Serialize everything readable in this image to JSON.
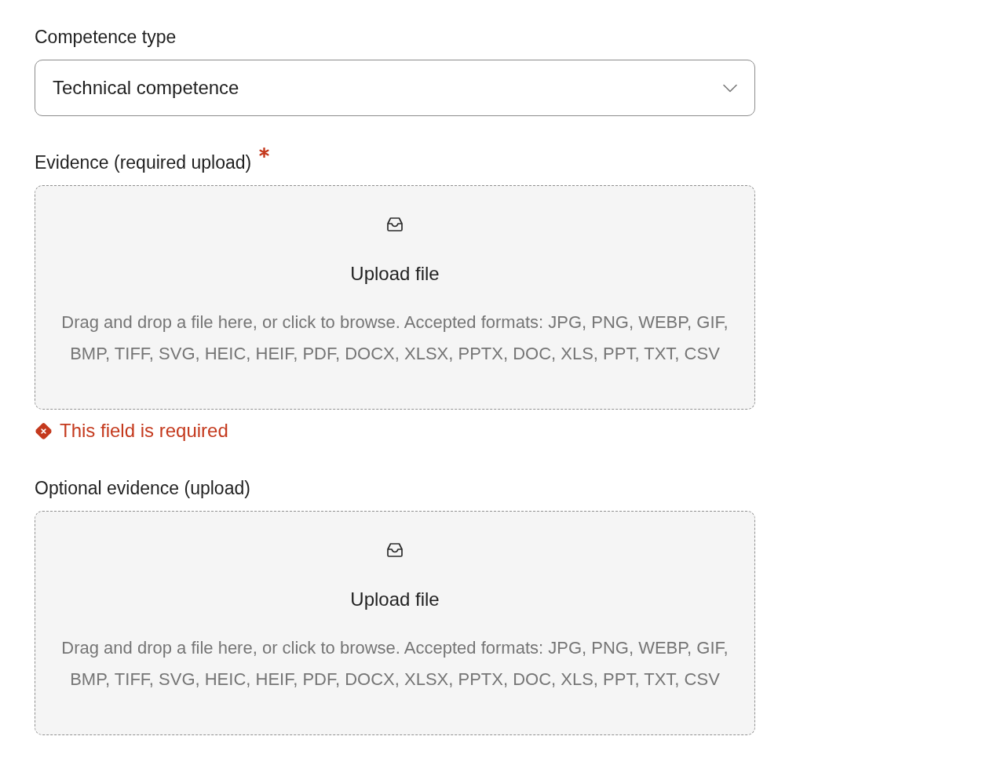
{
  "fields": [
    {
      "kind": "select",
      "label": "Competence type",
      "required": false,
      "value": "Technical competence"
    },
    {
      "kind": "upload",
      "label": "Evidence (required upload)",
      "required": true,
      "title": "Upload file",
      "hint": "Drag and drop a file here, or click to browse. Accepted formats: JPG, PNG, WEBP, GIF, BMP, TIFF, SVG, HEIC, HEIF, PDF, DOCX, XLSX, PPTX, DOC, XLS, PPT, TXT, CSV",
      "error": "This field is required"
    },
    {
      "kind": "upload",
      "label": "Optional evidence (upload)",
      "required": false,
      "title": "Upload file",
      "hint": "Drag and drop a file here, or click to browse. Accepted formats: JPG, PNG, WEBP, GIF, BMP, TIFF, SVG, HEIC, HEIF, PDF, DOCX, XLSX, PPTX, DOC, XLS, PPT, TXT, CSV"
    }
  ]
}
